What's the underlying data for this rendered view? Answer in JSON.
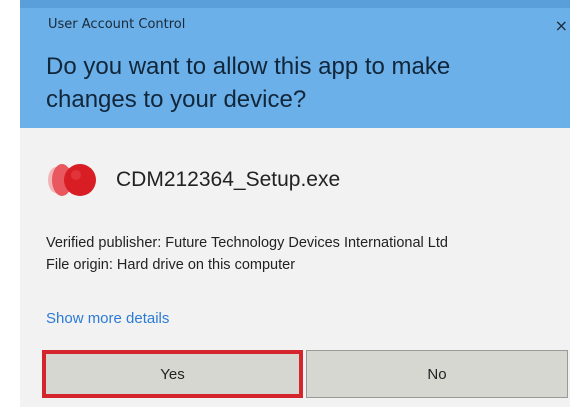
{
  "dialog": {
    "title": "User Account Control",
    "close_glyph": "×",
    "question": "Do you want to allow this app to make changes to your device?",
    "app_name": "CDM212364_Setup.exe",
    "app_icon": "setup-app-icon",
    "publisher": "Verified publisher: Future Technology Devices International Ltd",
    "origin": "File origin: Hard drive on this computer",
    "more_details": "Show more details",
    "yes_label": "Yes",
    "no_label": "No"
  },
  "colors": {
    "header": "#6bb0e8",
    "body": "#f2f2f2",
    "link": "#2c7bd6",
    "highlight": "#d4242c",
    "button": "#d7d7d2"
  }
}
